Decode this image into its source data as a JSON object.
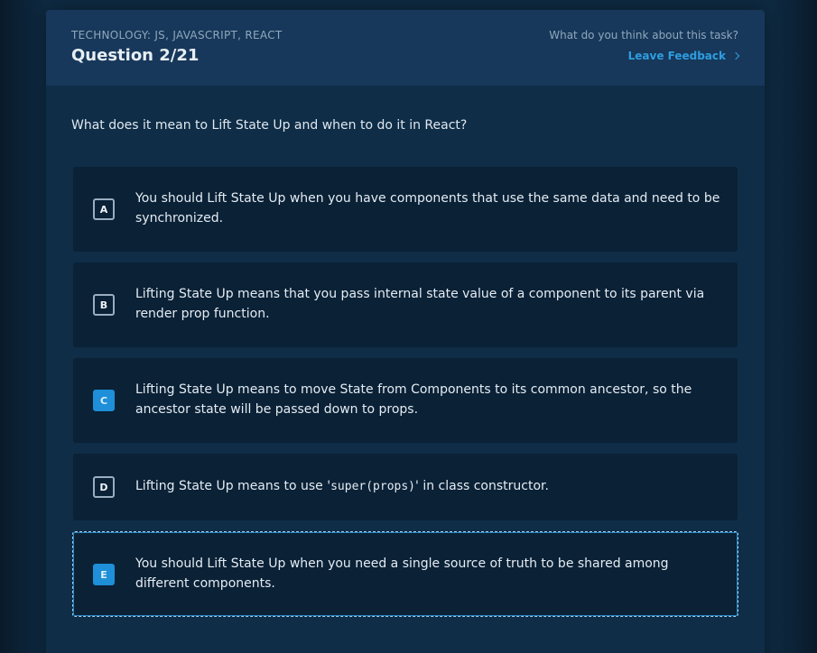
{
  "header": {
    "technology": "TECHNOLOGY: JS, JAVASCRIPT, REACT",
    "question_number": "Question 2/21",
    "feedback_prompt": "What do you think about this task?",
    "feedback_link": "Leave Feedback"
  },
  "question": {
    "text": "What does it mean to Lift State Up and when to do it in React?"
  },
  "options": [
    {
      "letter": "A",
      "text": "You should Lift State Up when you have components that use the same data and need to be synchronized."
    },
    {
      "letter": "B",
      "text": "Lifting State Up means that you pass internal state value of a component to its parent via render prop function."
    },
    {
      "letter": "C",
      "text": "Lifting State Up means to move State from Components to its common ancestor, so the ancestor state will be passed down to props."
    },
    {
      "letter": "D",
      "text_before": "Lifting State Up means to use '",
      "code": "super(props)",
      "text_after": "' in class constructor."
    },
    {
      "letter": "E",
      "text": "You should Lift State Up when you need a single source of truth to be shared among different components."
    }
  ],
  "colors": {
    "accent": "#1e8fd8",
    "link": "#2f9de0",
    "card_bg": "#0f2d47",
    "header_bg": "#17385a",
    "option_bg": "#0a2136"
  }
}
